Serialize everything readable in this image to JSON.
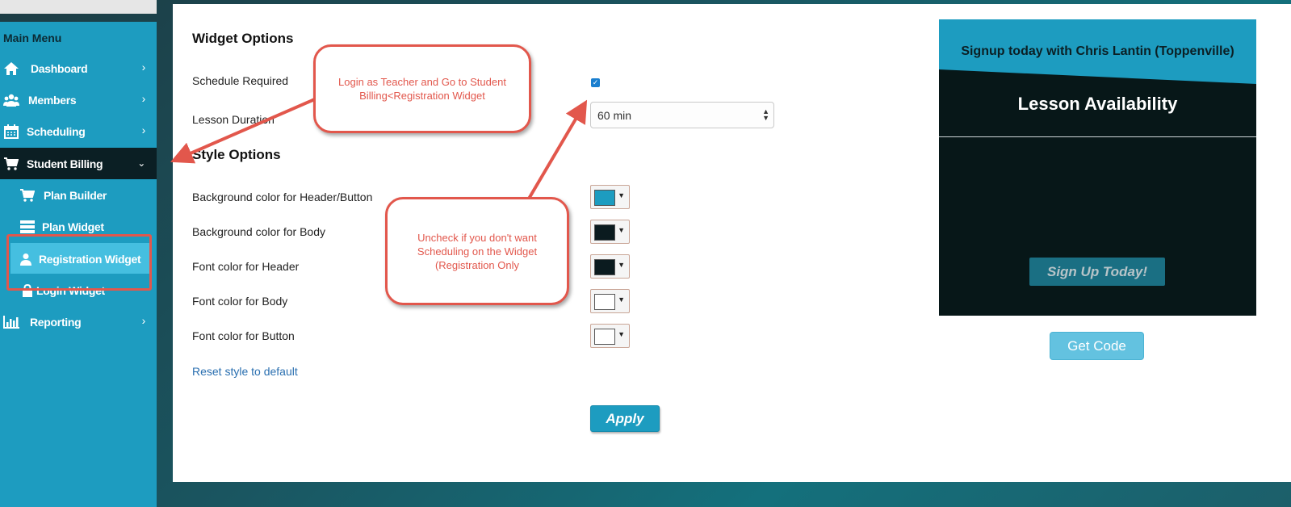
{
  "sidebar": {
    "title": "Main Menu",
    "items": [
      {
        "label": "Dashboard",
        "icon": "home-icon"
      },
      {
        "label": "Members",
        "icon": "users-icon"
      },
      {
        "label": "Scheduling",
        "icon": "calendar-icon"
      },
      {
        "label": "Student Billing",
        "icon": "cart-icon"
      },
      {
        "label": "Plan Builder",
        "icon": "cart-icon"
      },
      {
        "label": "Plan Widget",
        "icon": "list-icon"
      },
      {
        "label": "Registration Widget",
        "icon": "user-icon"
      },
      {
        "label": "Login Widget",
        "icon": "lock-icon"
      },
      {
        "label": "Reporting",
        "icon": "bar-chart-icon"
      }
    ]
  },
  "widget_options": {
    "title": "Widget Options",
    "schedule_required_label": "Schedule Required",
    "schedule_required_checked": true,
    "lesson_duration_label": "Lesson Duration",
    "lesson_duration_value": "60 min"
  },
  "style_options": {
    "title": "Style Options",
    "rows": [
      {
        "label": "Background color for Header/Button",
        "color": "#1d9cc0"
      },
      {
        "label": "Background color for Body",
        "color": "#0b1b1f"
      },
      {
        "label": "Font color for Header",
        "color": "#0b1b1f"
      },
      {
        "label": "Font color for Body",
        "color": "#ffffff"
      },
      {
        "label": "Font color for Button",
        "color": "#ffffff"
      }
    ],
    "reset_label": "Reset style to default",
    "apply_label": "Apply"
  },
  "preview": {
    "header_text": "Signup today with Chris Lantin (Toppenville)",
    "title": "Lesson Availability",
    "signup_label": "Sign Up Today!",
    "get_code_label": "Get Code"
  },
  "annotations": {
    "callout_1": "Login as Teacher and Go to Student Billing<Registration Widget",
    "callout_2": "Uncheck if you don't want Scheduling on the Widget (Registration Only"
  },
  "colors": {
    "accent": "#1d9cc0",
    "annotation": "#e2574c",
    "sidebar_active": "#0b1f24"
  }
}
